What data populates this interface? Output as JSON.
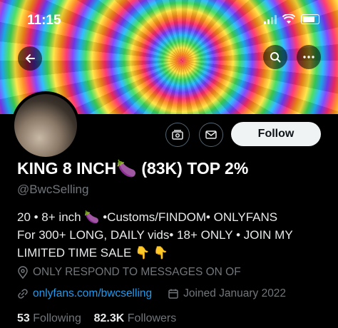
{
  "status_bar": {
    "time": "11:15"
  },
  "header": {
    "back_icon": "arrow-left-icon",
    "search_icon": "search-icon",
    "more_icon": "more-horizontal-icon"
  },
  "actions": {
    "subscriptions_icon": "subscriptions-icon",
    "message_icon": "envelope-icon",
    "follow_label": "Follow"
  },
  "profile": {
    "name": "KING 8 INCH🍆 (83K) TOP 2%",
    "handle": "@BwcSelling",
    "bio_lines": [
      "20 • 8+ inch 🍆 •Customs/FINDOM• ONLYFANS",
      "For 300+ LONG, DAILY vids• 18+ ONLY • JOIN MY",
      "LIMITED TIME SALE 👇 👇"
    ],
    "location": "ONLY RESPOND TO MESSAGES ON OF",
    "website": "onlyfans.com/bwcselling",
    "joined": "Joined January 2022"
  },
  "stats": {
    "following_count": "53",
    "following_label": "Following",
    "followers_count": "82.3K",
    "followers_label": "Followers"
  },
  "colors": {
    "background": "#000000",
    "accent": "#1d9bf0",
    "secondary_text": "#71767b"
  }
}
